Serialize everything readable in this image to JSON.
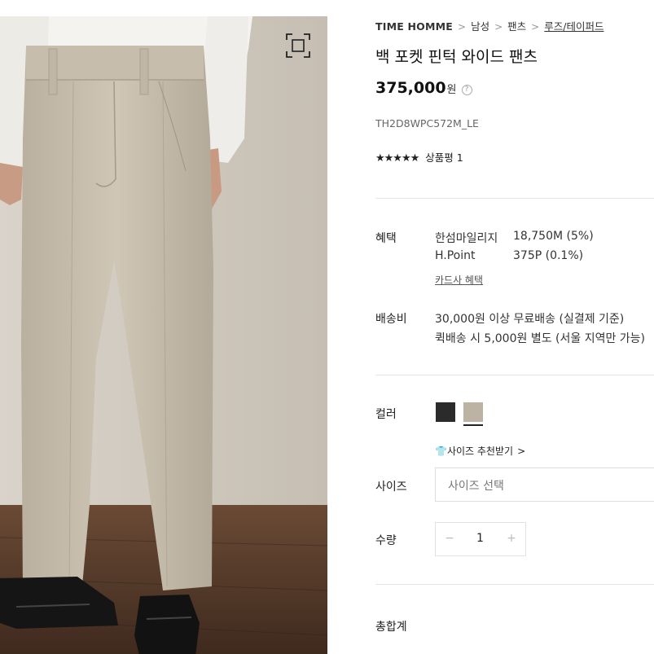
{
  "breadcrumb": {
    "brand": "TIME HOMME",
    "items": [
      "남성",
      "팬츠",
      "루즈/테이퍼드"
    ]
  },
  "product": {
    "title": "백 포켓 핀턱 와이드 팬츠",
    "price": "375,000",
    "price_unit": "원",
    "code": "TH2D8WPC572M_LE",
    "stars": "★★★★★",
    "review_label": "상품평 1"
  },
  "benefit": {
    "label": "혜택",
    "rows": [
      {
        "name": "한섬마일리지",
        "value": "18,750M (5%)"
      },
      {
        "name": "H.Point",
        "value": "375P (0.1%)"
      }
    ],
    "card_link": "카드사 혜택"
  },
  "shipping": {
    "label": "배송비",
    "lines": [
      "30,000원 이상 무료배송 (실결제 기준)",
      "퀵배송 시 5,000원 별도 (서울 지역만 가능)"
    ]
  },
  "color": {
    "label": "컬러",
    "options": [
      {
        "name": "black",
        "hex": "#2b2b2b"
      },
      {
        "name": "beige",
        "hex": "#bdb3a5",
        "selected": true
      }
    ]
  },
  "size": {
    "recommend_label": "사이즈 추천받기",
    "label": "사이즈",
    "placeholder": "사이즈 선택"
  },
  "quantity": {
    "label": "수량",
    "value": "1"
  },
  "total": {
    "label": "총합계"
  }
}
